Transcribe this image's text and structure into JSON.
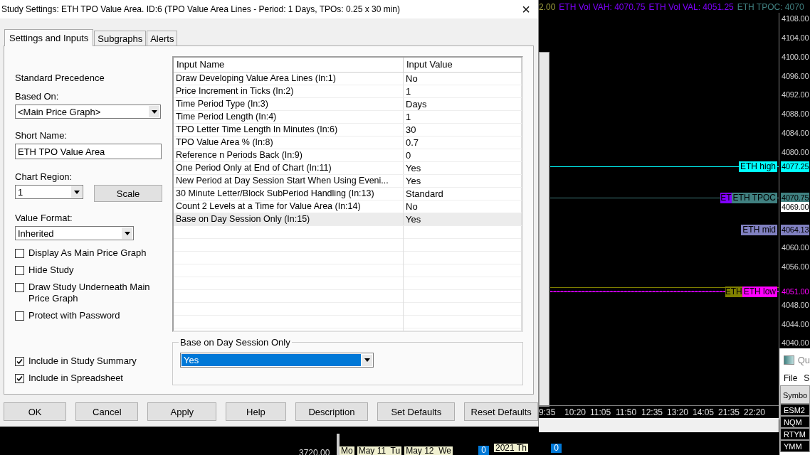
{
  "dialog": {
    "title": "Study Settings: ETH TPO Value Area. ID:6 (TPO Value Area Lines - Period: 1 Days, TPOs: 0.25 x 30 min)",
    "close": "×",
    "tabs": [
      {
        "label": "Settings and Inputs",
        "selected": true
      },
      {
        "label": "Subgraphs",
        "selected": false
      },
      {
        "label": "Alerts",
        "selected": false
      }
    ],
    "standard_precedence": "Standard Precedence",
    "based_on": {
      "label": "Based On:",
      "value": "<Main Price Graph>"
    },
    "short_name": {
      "label": "Short Name:",
      "value": "ETH TPO Value Area"
    },
    "chart_region": {
      "label": "Chart Region:",
      "value": "1",
      "button": "Scale"
    },
    "value_format": {
      "label": "Value Format:",
      "value": "Inherited"
    },
    "options": [
      {
        "label": "Display As Main Price Graph",
        "checked": false
      },
      {
        "label": "Hide Study",
        "checked": false
      },
      {
        "label": "Draw Study Underneath Main Price Graph",
        "checked": false
      },
      {
        "label": "Protect with Password",
        "checked": false
      }
    ],
    "summary_options": [
      {
        "label": "Include in Study Summary",
        "checked": true
      },
      {
        "label": "Include in Spreadsheet",
        "checked": true
      }
    ],
    "table": {
      "columns": [
        "Input Name",
        "Input Value"
      ],
      "rows": [
        {
          "name": "Draw Developing Value Area Lines   (In:1)",
          "value": "No",
          "selected": false
        },
        {
          "name": "Price Increment in Ticks   (In:2)",
          "value": "1",
          "selected": false
        },
        {
          "name": "Time Period Type   (In:3)",
          "value": "Days",
          "selected": false
        },
        {
          "name": "Time Period Length   (In:4)",
          "value": "1",
          "selected": false
        },
        {
          "name": "TPO Letter Time Length In Minutes   (In:6)",
          "value": "30",
          "selected": false
        },
        {
          "name": "TPO Value Area %   (In:8)",
          "value": "0.7",
          "selected": false
        },
        {
          "name": "Reference n Periods Back   (In:9)",
          "value": "0",
          "selected": false
        },
        {
          "name": "One Period Only at End of Chart   (In:11)",
          "value": "Yes",
          "selected": false
        },
        {
          "name": "New Period at Day Session Start When Using Eveni...",
          "value": "Yes",
          "selected": false
        },
        {
          "name": "30 Minute Letter/Block SubPeriod Handling   (In:13)",
          "value": "Standard",
          "selected": false
        },
        {
          "name": "Count 2 Levels at a Time for Value Area   (In:14)",
          "value": "No",
          "selected": false
        },
        {
          "name": "Base on Day Session Only   (In:15)",
          "value": "Yes",
          "selected": true
        }
      ]
    },
    "editor": {
      "title": "Base on Day Session Only",
      "value": "Yes"
    },
    "buttons": [
      "OK",
      "Cancel",
      "Apply",
      "Help",
      "Description",
      "Set Defaults",
      "Reset Defaults"
    ]
  },
  "chart": {
    "header": [
      {
        "text": "2.00",
        "color": "#a0a040"
      },
      {
        "text": "ETH Vol VAH: 4070.75",
        "color": "#8000ff"
      },
      {
        "text": "ETH Vol VAL: 4051.25",
        "color": "#8000ff"
      },
      {
        "text": "ETH TPOC: 4070",
        "color": "#408080"
      }
    ],
    "upper_ticks": [
      "4108.00",
      "4104.00",
      "4100.00",
      "4096.00",
      "4092.00",
      "4088.00",
      "4084.00",
      "4080.00"
    ],
    "lower_ticks": [
      "4060.00",
      "4056.00",
      "4048.00",
      "4044.00",
      "4040.00"
    ],
    "levels": [
      {
        "label": "ETH high",
        "value": "4077.25",
        "color": "#00ffff"
      },
      {
        "label": "ETH TPOC",
        "value": "4070.75",
        "color": "#408080",
        "tag": {
          "text": "ET",
          "color": "#8000ff"
        }
      },
      {
        "label": "ETH mid",
        "value": "4064.13",
        "color": "#8080c0"
      },
      {
        "label": "ETH low",
        "value": "4051.00",
        "color": "#ff00ff",
        "tag": {
          "text": "ETH",
          "color": "#808000"
        }
      }
    ],
    "last_price": "4069.00",
    "times": [
      "9:35",
      "10:20",
      "11:05",
      "11:50",
      "12:35",
      "13:20",
      "14:05",
      "21:35",
      "22:20"
    ]
  },
  "quote_window": {
    "title": "Qu",
    "menu": [
      "File",
      "S"
    ],
    "column": "Symbo",
    "symbols": [
      "ESM2",
      "NQM",
      "RTYM",
      "YMM"
    ]
  },
  "bottom_strip": {
    "price": "3720.00",
    "dates": [
      "Mo",
      "May 11  Tu",
      "May 12  We"
    ],
    "count": "0",
    "date2": "2021 Th",
    "count2": "0"
  }
}
